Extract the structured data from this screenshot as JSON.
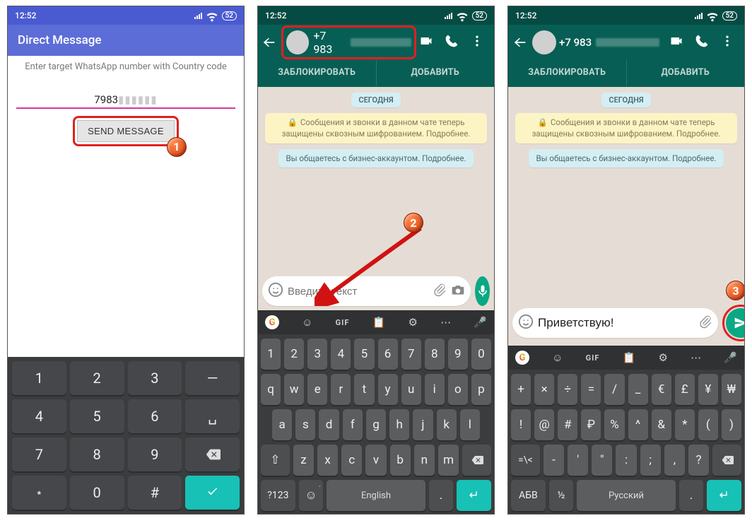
{
  "status": {
    "time": "12:52",
    "battery": "52"
  },
  "dm": {
    "title": "Direct Message",
    "instruction": "Enter target WhatsApp number with Country code",
    "number_visible": "7983",
    "send_label": "SEND MESSAGE",
    "step": "1"
  },
  "wa": {
    "phone_prefix": "+7 983",
    "tab_block": "ЗАБЛОКИРОВАТЬ",
    "tab_add": "ДОБАВИТЬ",
    "date": "СЕГОДНЯ",
    "e2e": "Сообщения и звонки в данном чате теперь защищены сквозным шифрованием. Подробнее.",
    "biz": "Вы общаетесь с бизнес-аккаунтом. Подробнее.",
    "placeholder": "Введите текст",
    "typed": "Приветствую!",
    "step2": "2",
    "step3": "3"
  },
  "kbd_en": {
    "numrow": [
      "1",
      "2",
      "3",
      "4",
      "5",
      "6",
      "7",
      "8",
      "9",
      "0"
    ],
    "row1": [
      "q",
      "w",
      "e",
      "r",
      "t",
      "y",
      "u",
      "i",
      "o",
      "p"
    ],
    "row2": [
      "a",
      "s",
      "d",
      "f",
      "g",
      "h",
      "j",
      "k",
      "l"
    ],
    "row3": [
      "z",
      "x",
      "c",
      "v",
      "b",
      "n",
      "m"
    ],
    "sym": "?123",
    "lang": "English",
    "gif": "GIF"
  },
  "kbd_ru": {
    "row1": [
      "+",
      "×",
      "÷",
      "=",
      "/",
      "_",
      "€",
      "£",
      "¥",
      "₩"
    ],
    "row2": [
      "!",
      "@",
      "#",
      "₽",
      "%",
      "^",
      "&",
      "*",
      "(",
      ")"
    ],
    "row3": [
      "-",
      "'",
      "\"",
      ":",
      ";",
      ",",
      "?"
    ],
    "sym_label": "=\\<",
    "abv": "АБВ",
    "frac": "½",
    "lang": "Русский"
  },
  "numpad": {
    "keys": [
      [
        "1",
        "2",
        "3",
        "-"
      ],
      [
        "4",
        "5",
        "6",
        "␣"
      ],
      [
        "7",
        "8",
        "9",
        "⌫"
      ],
      [
        "*",
        "0",
        "#",
        "✓"
      ]
    ]
  }
}
